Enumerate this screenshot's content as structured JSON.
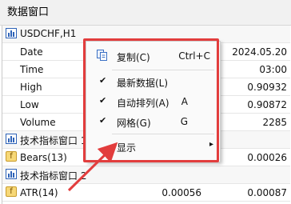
{
  "window": {
    "title": "数据窗口"
  },
  "groups": [
    {
      "header": "USDCHF,H1"
    },
    {
      "header": "技术指标窗口 1"
    },
    {
      "header": "技术指标窗口 2"
    }
  ],
  "rows": {
    "date": {
      "label": "Date",
      "value": "2024.05.20"
    },
    "time": {
      "label": "Time",
      "value": "03:00"
    },
    "high": {
      "label": "High",
      "value": "0.90932"
    },
    "low": {
      "label": "Low",
      "value": "0.90872"
    },
    "volume": {
      "label": "Volume",
      "value": "2285"
    },
    "bears": {
      "label": "Bears(13)",
      "value": "0.00026"
    },
    "atr": {
      "label": "ATR(14)",
      "value1": "0.00056",
      "value2": "0.00087"
    }
  },
  "indicator_icons": {
    "bears": "f",
    "atr": "f"
  },
  "context_menu": {
    "copy": {
      "label": "复制(C)",
      "shortcut": "Ctrl+C",
      "icon": "copy-icon"
    },
    "latest_data": {
      "label": "最新数据(L)",
      "checked": true
    },
    "auto_arrange": {
      "label": "自动排列(A)",
      "shortcut": "A",
      "checked": true
    },
    "grid": {
      "label": "网格(G)",
      "shortcut": "G",
      "checked": true
    },
    "show": {
      "label": "显示",
      "submenu_arrow": "▸"
    }
  },
  "colors": {
    "highlight": "#e23d3d",
    "chart_icon": "#2e63b8"
  }
}
